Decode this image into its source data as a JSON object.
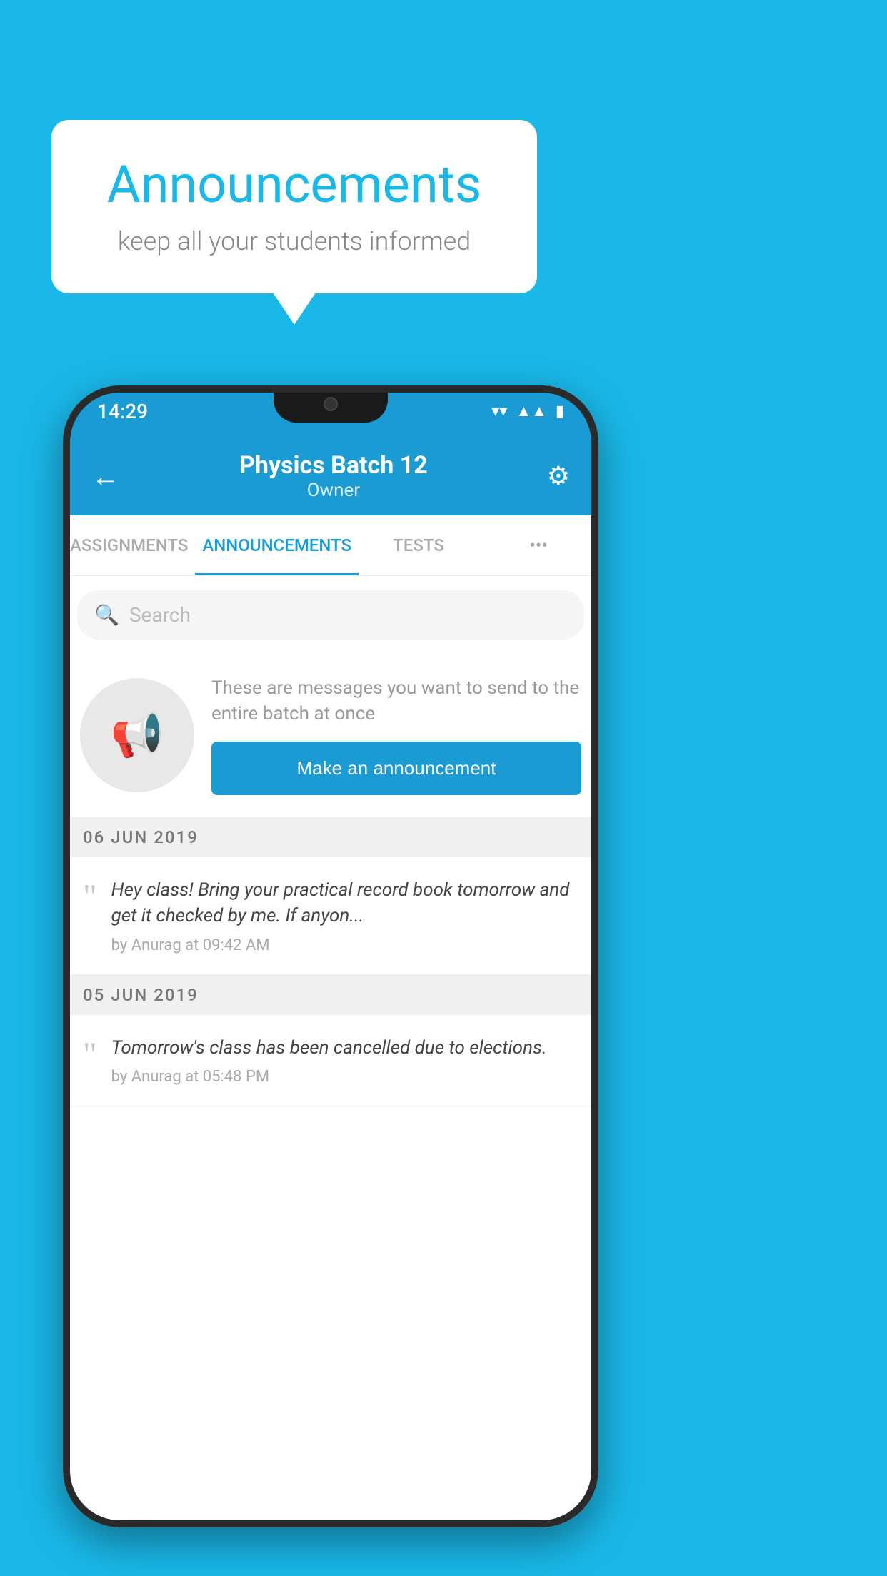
{
  "background_color": "#1ab8e8",
  "speech_bubble": {
    "title": "Announcements",
    "subtitle": "keep all your students informed"
  },
  "phone": {
    "status_bar": {
      "time": "14:29",
      "icons": [
        "wifi",
        "signal",
        "battery"
      ]
    },
    "header": {
      "title": "Physics Batch 12",
      "subtitle": "Owner",
      "back_label": "←",
      "settings_label": "⚙"
    },
    "tabs": [
      {
        "label": "ASSIGNMENTS",
        "active": false
      },
      {
        "label": "ANNOUNCEMENTS",
        "active": true
      },
      {
        "label": "TESTS",
        "active": false
      },
      {
        "label": "•••",
        "active": false
      }
    ],
    "search": {
      "placeholder": "Search"
    },
    "empty_state": {
      "description": "These are messages you want to send to the entire batch at once",
      "button_label": "Make an announcement"
    },
    "announcements": [
      {
        "date": "06  JUN  2019",
        "text": "Hey class! Bring your practical record book tomorrow and get it checked by me. If anyon...",
        "meta": "by Anurag at 09:42 AM"
      },
      {
        "date": "05  JUN  2019",
        "text": "Tomorrow's class has been cancelled due to elections.",
        "meta": "by Anurag at 05:48 PM"
      }
    ]
  }
}
